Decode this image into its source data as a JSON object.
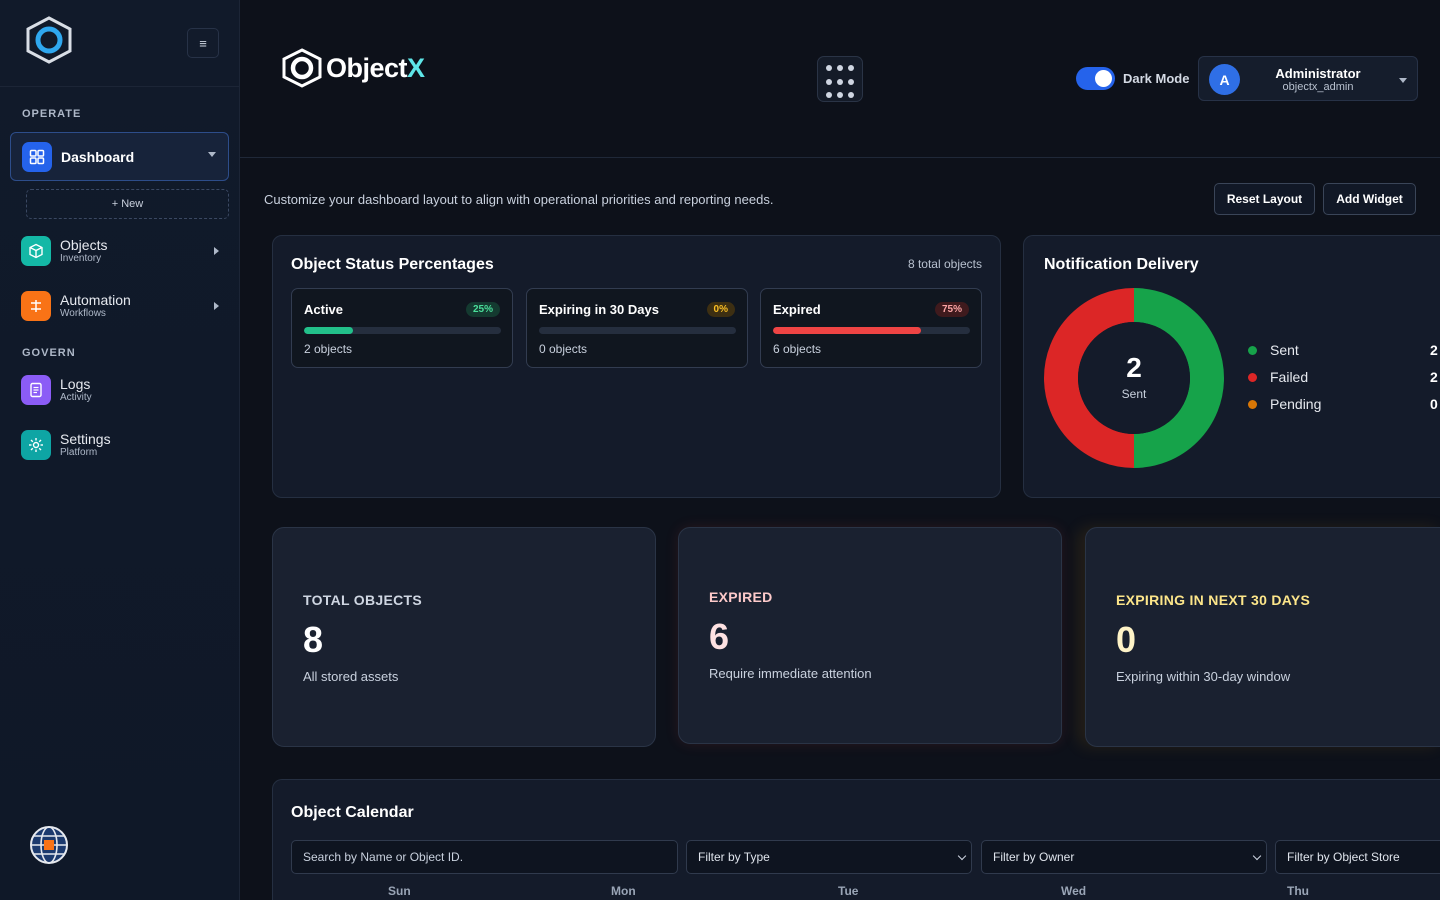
{
  "sidebar": {
    "menu_icon": "≡",
    "sections": {
      "operate": "OPERATE",
      "govern": "GOVERN"
    },
    "dashboard": {
      "label": "Dashboard",
      "icon": "dashboard-icon",
      "color": "#2563eb"
    },
    "new_label": "+ New",
    "items": [
      {
        "label": "Objects",
        "sub": "Inventory",
        "icon": "cube-icon",
        "color": "#14b8a6"
      },
      {
        "label": "Automation",
        "sub": "Workflows",
        "icon": "workflow-icon",
        "color": "#f97316"
      },
      {
        "label": "Logs",
        "sub": "Activity",
        "icon": "log-icon",
        "color": "#8b5cf6"
      },
      {
        "label": "Settings",
        "sub": "Platform",
        "icon": "gear-icon",
        "color": "#0ea5a4"
      }
    ]
  },
  "header": {
    "brand": {
      "main": "Object",
      "accent": "X"
    },
    "dark_mode": {
      "label": "Dark Mode",
      "enabled": true
    },
    "user": {
      "initial": "A",
      "name": "Administrator",
      "id": "objectx_admin"
    }
  },
  "intro_text": "Customize your dashboard layout to align with operational priorities and reporting needs.",
  "actions": {
    "reset": "Reset Layout",
    "add": "Add Widget"
  },
  "status_panel": {
    "title": "Object Status Percentages",
    "total": "8 total objects",
    "cards": [
      {
        "name": "Active",
        "pct": "25%",
        "fraction": 0.25,
        "count": "2 objects",
        "color": "#22c08a",
        "badge_bg": "#143a30",
        "badge_fg": "#4ade9a"
      },
      {
        "name": "Expiring in 30 Days",
        "pct": "0%",
        "fraction": 0.0,
        "count": "0 objects",
        "color": "#f59e0b",
        "badge_bg": "#3d2f12",
        "badge_fg": "#fbbf24"
      },
      {
        "name": "Expired",
        "pct": "75%",
        "fraction": 0.75,
        "count": "6 objects",
        "color": "#ef4444",
        "badge_bg": "#3f1a1d",
        "badge_fg": "#fca5a5"
      }
    ]
  },
  "notification_panel": {
    "title": "Notification Delivery",
    "center_value": "2",
    "center_label": "Sent",
    "legend": [
      {
        "label": "Sent",
        "value": "2",
        "color": "#16a34a"
      },
      {
        "label": "Failed",
        "value": "2",
        "color": "#dc2626"
      },
      {
        "label": "Pending",
        "value": "0",
        "color": "#d97706"
      }
    ]
  },
  "kpis": [
    {
      "label": "TOTAL OBJECTS",
      "value": "8",
      "sub": "All stored assets",
      "label_color": "#cfd6e2",
      "value_color": "#ffffff"
    },
    {
      "label": "EXPIRED",
      "value": "6",
      "sub": "Require immediate attention",
      "label_color": "#fecaca",
      "value_color": "#fee2e2"
    },
    {
      "label": "EXPIRING IN NEXT 30 DAYS",
      "value": "0",
      "sub": "Expiring within 30-day window",
      "label_color": "#fde68a",
      "value_color": "#fef3c7"
    }
  ],
  "calendar": {
    "title": "Object Calendar",
    "search_placeholder": "Search by Name or Object ID.",
    "filters": [
      "Filter by Type",
      "Filter by Owner",
      "Filter by Object Store"
    ],
    "days": [
      "Sun",
      "Mon",
      "Tue",
      "Wed",
      "Thu"
    ]
  }
}
